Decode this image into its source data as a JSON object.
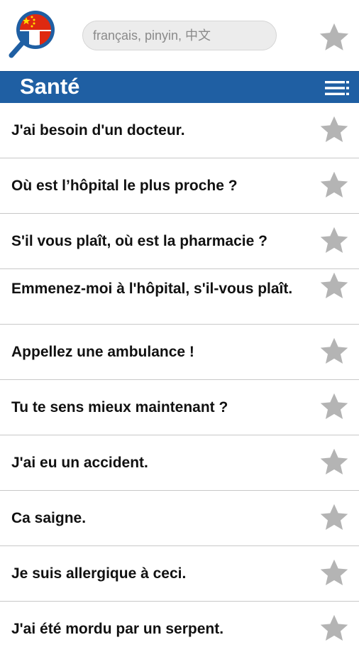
{
  "header": {
    "search": {
      "placeholder": "français, pinyin, 中文",
      "value": ""
    },
    "logo_icon": "magnifier-flags-logo",
    "favorites_icon": "star-icon"
  },
  "category": {
    "title": "Santé",
    "menu_icon": "list-menu-icon"
  },
  "phrases": [
    {
      "text": "J'ai besoin d'un docteur."
    },
    {
      "text": "Où est l’hôpital le plus proche ?"
    },
    {
      "text": "S'il vous plaît, où est la pharmacie ?"
    },
    {
      "text": "Emmenez-moi à l'hôpital, s'il-vous plaît."
    },
    {
      "text": "Appellez une ambulance !"
    },
    {
      "text": "Tu te sens mieux maintenant ?"
    },
    {
      "text": "J'ai eu un accident."
    },
    {
      "text": "Ca saigne."
    },
    {
      "text": "Je suis allergique à ceci."
    },
    {
      "text": "J'ai été mordu par un serpent."
    }
  ],
  "colors": {
    "accent": "#1f5fa3",
    "star": "#b4b4b4"
  }
}
